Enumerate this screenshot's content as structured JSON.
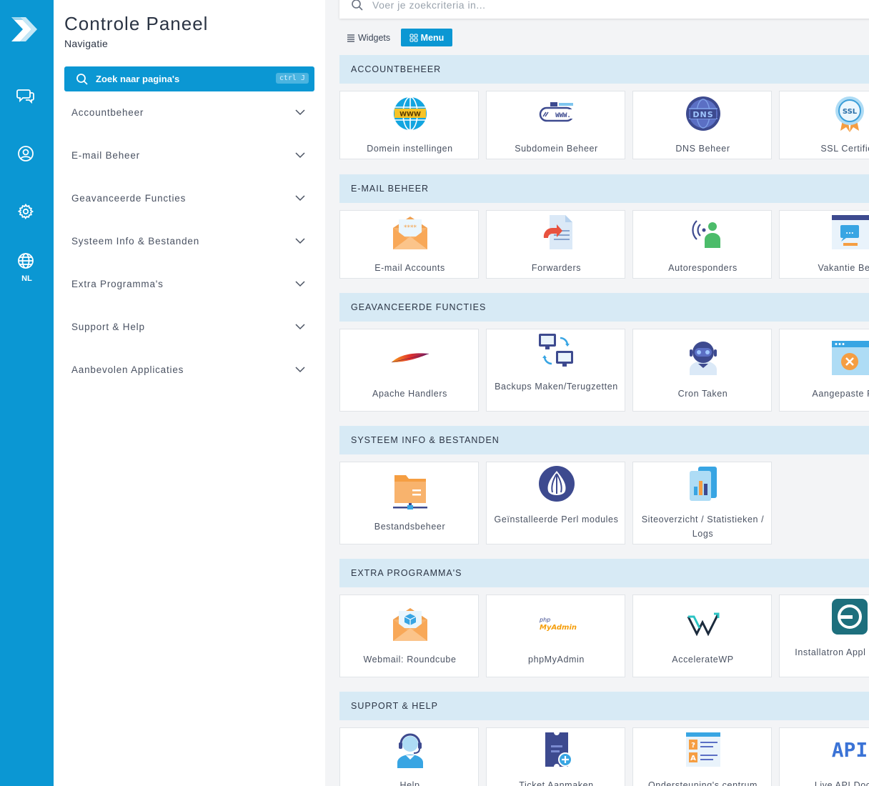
{
  "rail": {
    "language": "NL"
  },
  "nav": {
    "title": "Controle Paneel",
    "subtitle": "Navigatie",
    "search_label": "Zoek naar pagina's",
    "search_shortcut": "ctrl J",
    "items": [
      {
        "label": "Accountbeheer"
      },
      {
        "label": "E-mail Beheer"
      },
      {
        "label": "Geavanceerde Functies"
      },
      {
        "label": "Systeem Info & Bestanden"
      },
      {
        "label": "Extra Programma's"
      },
      {
        "label": "Support & Help"
      },
      {
        "label": "Aanbevolen Applicaties"
      }
    ]
  },
  "main": {
    "search_placeholder": "Voer je zoekcriteria in...",
    "view_widgets": "Widgets",
    "view_menu": "Menu",
    "sections": [
      {
        "title": "ACCOUNTBEHEER",
        "cards": [
          {
            "label": "Domein instellingen",
            "icon": "globe-www-icon"
          },
          {
            "label": "Subdomein Beheer",
            "icon": "subdomain-icon"
          },
          {
            "label": "DNS Beheer",
            "icon": "dns-globe-icon"
          },
          {
            "label": "SSL Certifica",
            "icon": "ssl-badge-icon"
          }
        ]
      },
      {
        "title": "E-MAIL BEHEER",
        "cards": [
          {
            "label": "E-mail Accounts",
            "icon": "envelope-icon"
          },
          {
            "label": "Forwarders",
            "icon": "forward-document-icon"
          },
          {
            "label": "Autoresponders",
            "icon": "broadcast-person-icon"
          },
          {
            "label": "Vakantie Beric",
            "icon": "vacation-message-icon"
          }
        ]
      },
      {
        "title": "GEAVANCEERDE FUNCTIES",
        "cards": [
          {
            "label": "Apache Handlers",
            "icon": "apache-feather-icon"
          },
          {
            "label": "Backups Maken/Terugzetten",
            "icon": "backup-monitors-icon"
          },
          {
            "label": "Cron Taken",
            "icon": "robot-icon"
          },
          {
            "label": "Aangepaste Fout",
            "icon": "error-window-icon"
          }
        ]
      },
      {
        "title": "SYSTEEM INFO & BESTANDEN",
        "cards": [
          {
            "label": "Bestandsbeheer",
            "icon": "folder-network-icon"
          },
          {
            "label": "Geïnstalleerde Perl modules",
            "icon": "perl-onion-icon"
          },
          {
            "label": "Siteoverzicht / Statistieken / Logs",
            "icon": "statistics-icon"
          }
        ]
      },
      {
        "title": "EXTRA PROGRAMMA'S",
        "cards": [
          {
            "label": "Webmail: Roundcube",
            "icon": "roundcube-icon"
          },
          {
            "label": "phpMyAdmin",
            "icon": "phpmyadmin-icon",
            "logo_text_1": "php",
            "logo_text_2": "MyAdmin"
          },
          {
            "label": "AccelerateWP",
            "icon": "acceleratewp-icon"
          },
          {
            "label": "Installatron Appl Installer",
            "icon": "installatron-icon"
          }
        ]
      },
      {
        "title": "SUPPORT & HELP",
        "cards": [
          {
            "label": "Help",
            "icon": "headset-agent-icon"
          },
          {
            "label": "Ticket Aanmaken",
            "icon": "ticket-icon"
          },
          {
            "label": "Ondersteuning's centrum",
            "icon": "support-document-icon"
          },
          {
            "label": "Live API Docum",
            "icon": "api-icon",
            "logo_text": "API"
          }
        ]
      }
    ]
  },
  "colors": {
    "primary": "#0b97d3",
    "section_bg": "#d7eaf5",
    "page_bg": "#f3f4f6"
  }
}
